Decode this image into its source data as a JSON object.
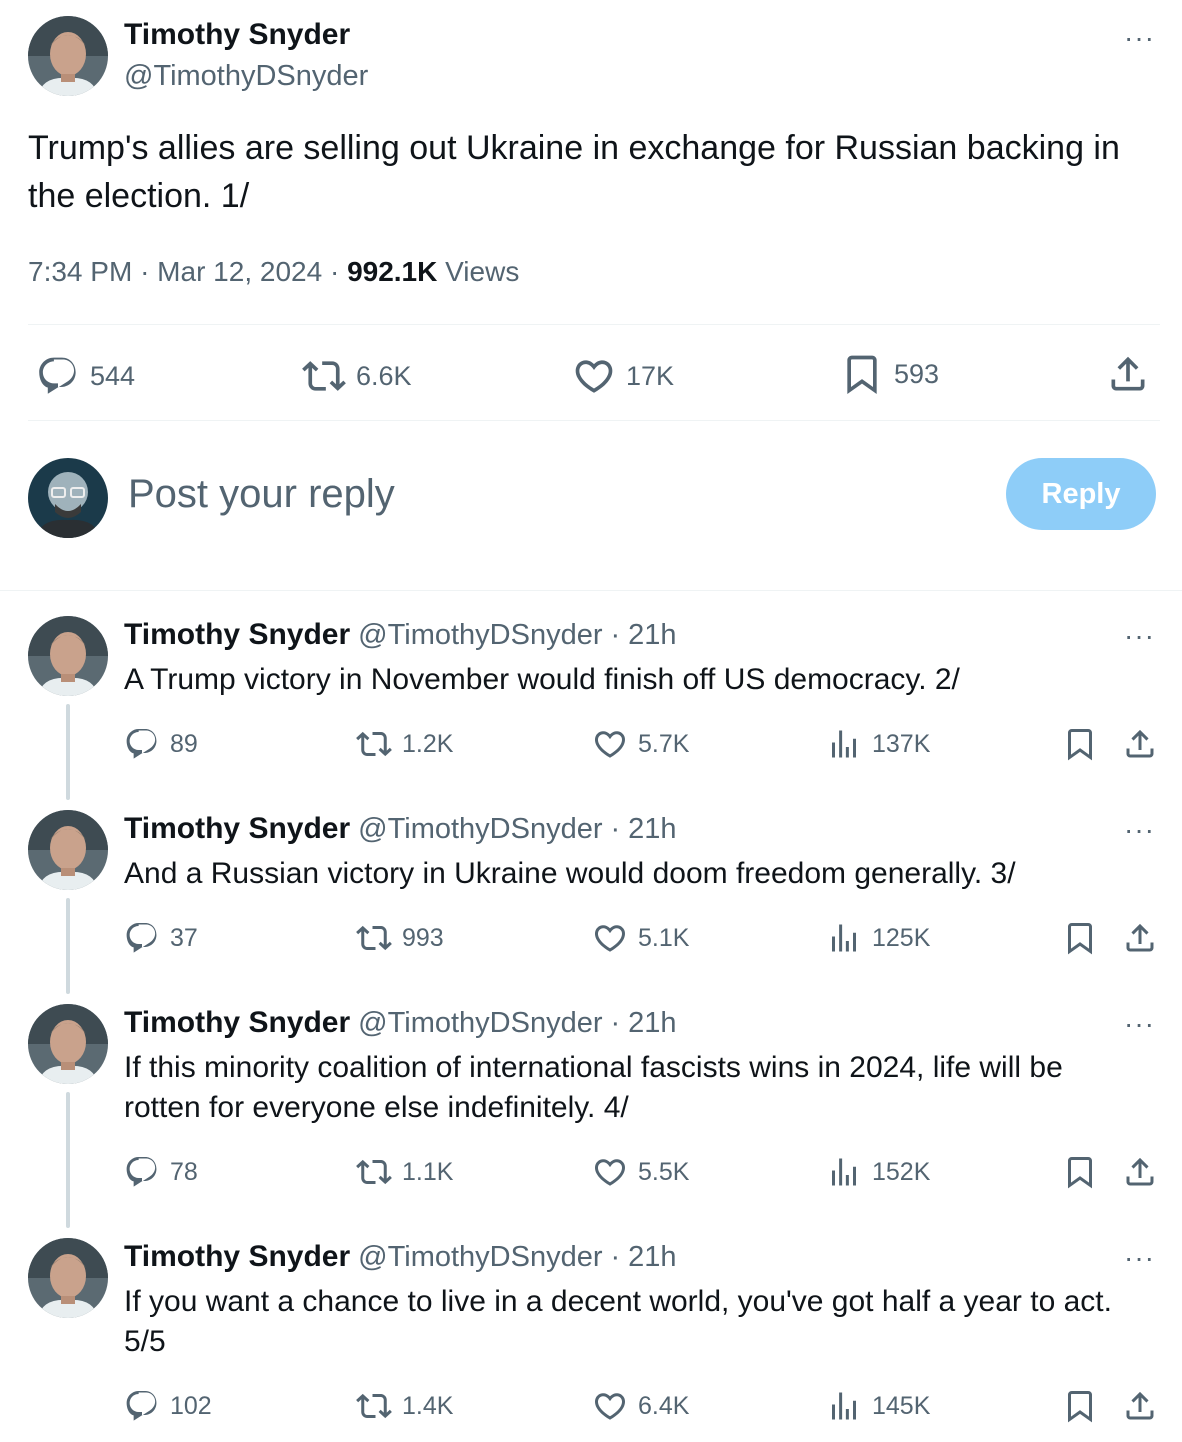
{
  "main": {
    "author_name": "Timothy Snyder",
    "author_handle": "@TimothyDSnyder",
    "more": "···",
    "text": "Trump's allies are selling out Ukraine in exchange for Russian backing in the election. 1/",
    "time": "7:34 PM",
    "sep1": "·",
    "date": "Mar 12, 2024",
    "sep2": "·",
    "views_count": "992.1K",
    "views_label": "Views",
    "stats": {
      "replies": "544",
      "reposts": "6.6K",
      "likes": "17K",
      "bookmarks": "593"
    }
  },
  "composer": {
    "placeholder": "Post your reply",
    "button": "Reply"
  },
  "thread": [
    {
      "name": "Timothy Snyder",
      "handle": "@TimothyDSnyder",
      "sep": "·",
      "time": "21h",
      "text": "A Trump victory in November would finish off US democracy. 2/",
      "replies": "89",
      "reposts": "1.2K",
      "likes": "5.7K",
      "views": "137K"
    },
    {
      "name": "Timothy Snyder",
      "handle": "@TimothyDSnyder",
      "sep": "·",
      "time": "21h",
      "text": "And a Russian victory in Ukraine would doom freedom generally. 3/",
      "replies": "37",
      "reposts": "993",
      "likes": "5.1K",
      "views": "125K"
    },
    {
      "name": "Timothy Snyder",
      "handle": "@TimothyDSnyder",
      "sep": "·",
      "time": "21h",
      "text": "If this minority coalition of international fascists wins in 2024, life will be rotten for everyone else indefinitely. 4/",
      "replies": "78",
      "reposts": "1.1K",
      "likes": "5.5K",
      "views": "152K"
    },
    {
      "name": "Timothy Snyder",
      "handle": "@TimothyDSnyder",
      "sep": "·",
      "time": "21h",
      "text": "If you want a chance to live in a decent world, you've got half a year to act. 5/5",
      "replies": "102",
      "reposts": "1.4K",
      "likes": "6.4K",
      "views": "145K"
    }
  ],
  "colors": {
    "text": "#0f1419",
    "secondary": "#536471",
    "reply_button": "#8ecdf8",
    "divider": "#eff3f4"
  }
}
